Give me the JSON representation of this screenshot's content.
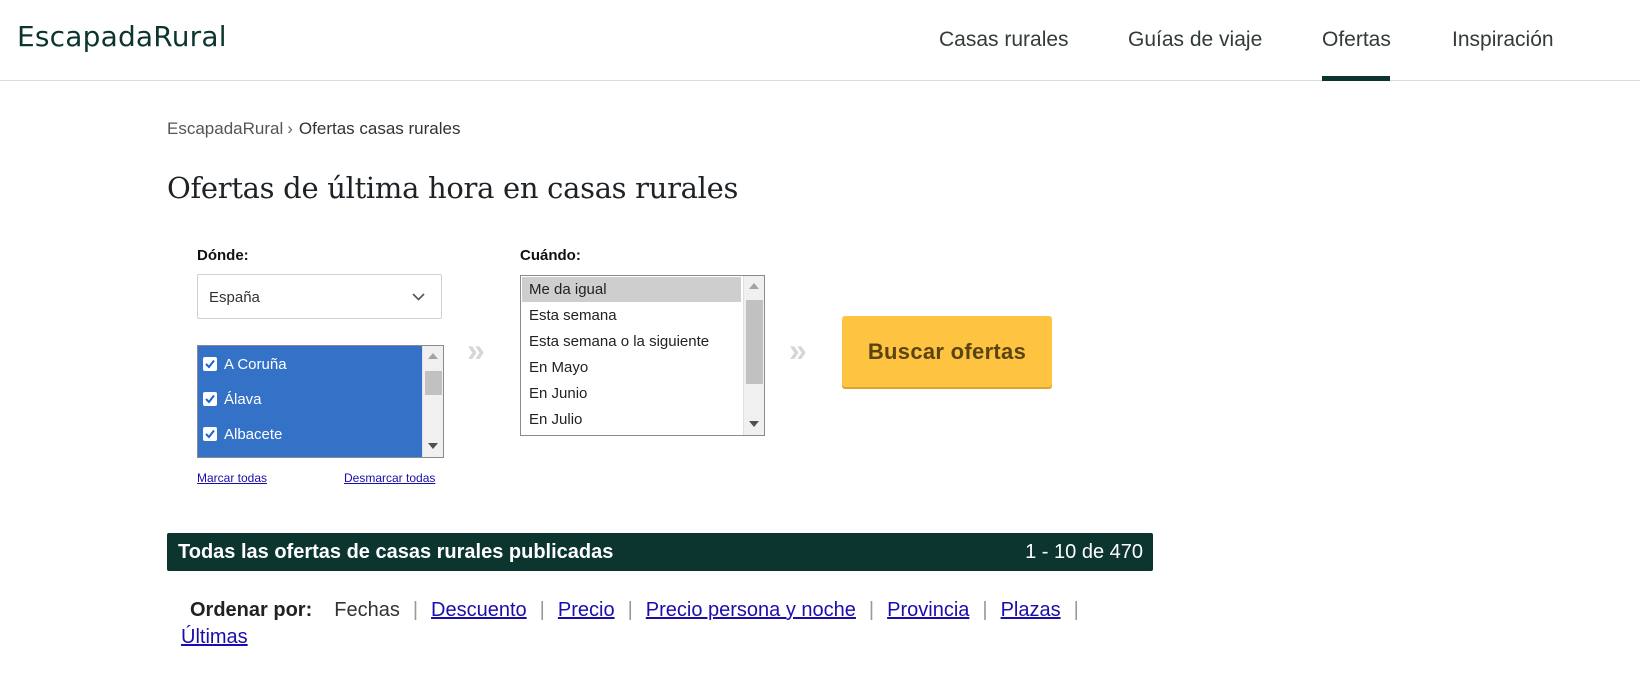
{
  "header": {
    "logo": "EscapadaRural",
    "nav": [
      {
        "label": "Casas rurales"
      },
      {
        "label": "Guías de viaje"
      },
      {
        "label": "Ofertas",
        "active": true
      },
      {
        "label": "Inspiración"
      }
    ]
  },
  "breadcrumb": {
    "home": "EscapadaRural",
    "separator": "›",
    "current": "Ofertas casas rurales"
  },
  "page_title": "Ofertas de última hora en casas rurales",
  "search": {
    "where_label": "Dónde:",
    "where_selected": "España",
    "provinces": [
      {
        "label": "A Coruña",
        "checked": true
      },
      {
        "label": "Álava",
        "checked": true
      },
      {
        "label": "Albacete",
        "checked": true
      }
    ],
    "mark_all": "Marcar todas",
    "unmark_all": "Desmarcar todas",
    "chevron_glyph": "»",
    "when_label": "Cuándo:",
    "when_options": [
      {
        "label": "Me da igual",
        "selected": true
      },
      {
        "label": "Esta semana"
      },
      {
        "label": "Esta semana o la siguiente"
      },
      {
        "label": "En Mayo"
      },
      {
        "label": "En Junio"
      },
      {
        "label": "En Julio"
      }
    ],
    "submit_label": "Buscar ofertas"
  },
  "results": {
    "title": "Todas las ofertas de casas rurales publicadas",
    "count": "1 - 10 de 470"
  },
  "sort": {
    "label": "Ordenar por:",
    "current": "Fechas",
    "separator": "|",
    "options": [
      "Descuento",
      "Precio",
      "Precio persona y noche",
      "Provincia",
      "Plazas"
    ],
    "last": "Últimas"
  },
  "colors": {
    "brand_dark": "#0d3530",
    "button_yellow": "#ffc342",
    "selection_blue": "#3472c8",
    "link_blue": "#1a0dab"
  }
}
